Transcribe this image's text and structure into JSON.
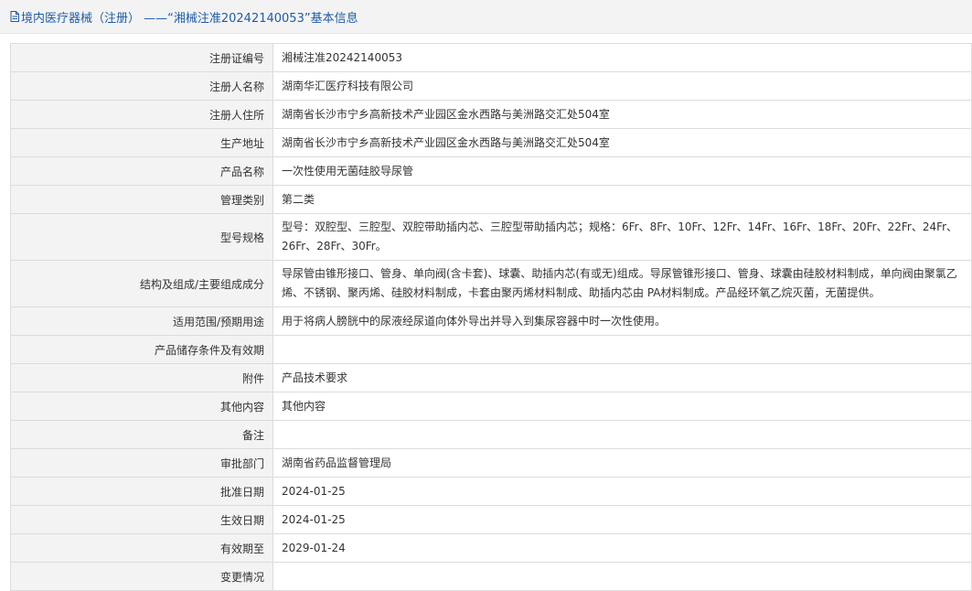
{
  "header": {
    "icon": "document-icon",
    "title": "境内医疗器械（注册） ——“湘械注准20242140053”基本信息"
  },
  "rows": [
    {
      "label": "注册证编号",
      "value": "湘械注准20242140053"
    },
    {
      "label": "注册人名称",
      "value": "湖南华汇医疗科技有限公司"
    },
    {
      "label": "注册人住所",
      "value": "湖南省长沙市宁乡高新技术产业园区金水西路与美洲路交汇处504室"
    },
    {
      "label": "生产地址",
      "value": "湖南省长沙市宁乡高新技术产业园区金水西路与美洲路交汇处504室"
    },
    {
      "label": "产品名称",
      "value": "一次性使用无菌硅胶导尿管"
    },
    {
      "label": "管理类别",
      "value": "第二类"
    },
    {
      "label": "型号规格",
      "value": "型号：双腔型、三腔型、双腔带助插内芯、三腔型带助插内芯；规格：6Fr、8Fr、10Fr、12Fr、14Fr、16Fr、18Fr、20Fr、22Fr、24Fr、26Fr、28Fr、30Fr。"
    },
    {
      "label": "结构及组成/主要组成成分",
      "value": "导尿管由锥形接口、管身、单向阀(含卡套)、球囊、助插内芯(有或无)组成。导尿管锥形接口、管身、球囊由硅胶材料制成，单向阀由聚氯乙烯、不锈钢、聚丙烯、硅胶材料制成，卡套由聚丙烯材料制成、助插内芯由 PA材料制成。产品经环氧乙烷灭菌，无菌提供。"
    },
    {
      "label": "适用范围/预期用途",
      "value": "用于将病人膀胱中的尿液经尿道向体外导出并导入到集尿容器中时一次性使用。"
    },
    {
      "label": "产品储存条件及有效期",
      "value": ""
    },
    {
      "label": "附件",
      "value": "产品技术要求"
    },
    {
      "label": "其他内容",
      "value": "其他内容"
    },
    {
      "label": "备注",
      "value": ""
    },
    {
      "label": "审批部门",
      "value": "湖南省药品监督管理局"
    },
    {
      "label": "批准日期",
      "value": "2024-01-25"
    },
    {
      "label": "生效日期",
      "value": "2024-01-25"
    },
    {
      "label": "有效期至",
      "value": "2029-01-24"
    },
    {
      "label": "变更情况",
      "value": ""
    }
  ]
}
